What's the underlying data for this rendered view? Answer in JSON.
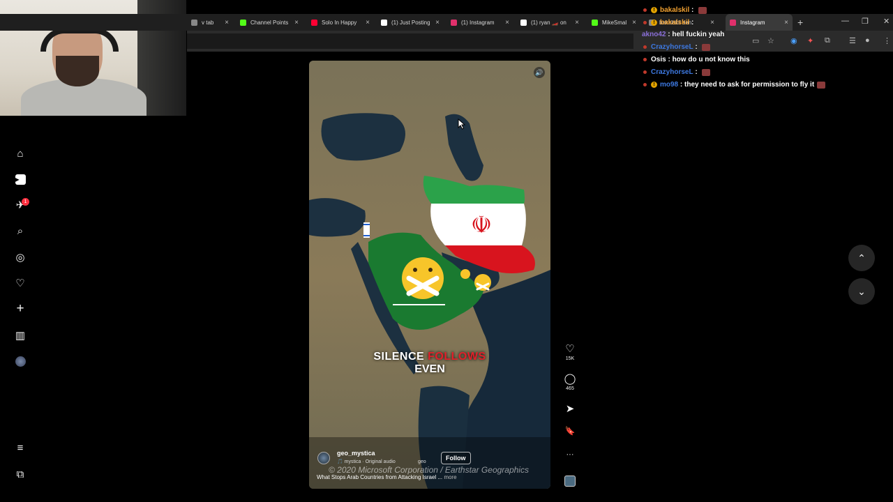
{
  "browser": {
    "tabs": [
      {
        "label": "v tab",
        "color": "#888888"
      },
      {
        "label": "Channel Points",
        "color": "#53fc18"
      },
      {
        "label": "Solo In Happy",
        "color": "#ff0033"
      },
      {
        "label": "(1) Just Posting",
        "color": "#ffffff"
      },
      {
        "label": "(1) Instagram",
        "color": "#e1306c"
      },
      {
        "label": "(1) ryan 🏎️ on",
        "color": "#ffffff"
      },
      {
        "label": "MikeSmallsJr",
        "color": "#53fc18"
      },
      {
        "label": "bakalskil den",
        "color": "#888888"
      },
      {
        "label": "Instagram",
        "color": "#e1306c"
      }
    ],
    "new_tab": "+",
    "minimize": "—",
    "restore": "❐",
    "close": "✕"
  },
  "chat": [
    {
      "user": "bakalskil",
      "text": "",
      "user_color": "#f0a030",
      "badge": true,
      "emote": true
    },
    {
      "user": "bakalskil",
      "text": "",
      "user_color": "#f0a030",
      "badge": true,
      "emote": false
    },
    {
      "user": "akno42",
      "text": "hell fuckin yeah",
      "user_color": "#8a6fd8",
      "badge": false,
      "emote": false
    },
    {
      "user": "CrazyhorseL",
      "text": "",
      "user_color": "#3d78e0",
      "badge": false,
      "emote": true
    },
    {
      "user": "Osis",
      "text": "how do u not know this",
      "user_color": "#ffffff",
      "badge": false,
      "emote": false
    },
    {
      "user": "CrazyhorseL",
      "text": "",
      "user_color": "#3d78e0",
      "badge": false,
      "emote": true
    },
    {
      "user": "mo98",
      "text": "they need to ask for permission to fly it",
      "user_color": "#3d78e0",
      "badge": true,
      "emote": true
    }
  ],
  "nav": {
    "home": "⌂",
    "reels": "▶",
    "messages": "✈",
    "notif_count": "1",
    "search": "⌕",
    "explore": "◎",
    "notifications": "♡",
    "create": "+",
    "dashboard": "▥",
    "menu": "≡",
    "also_from_meta": "⧉"
  },
  "reel": {
    "caption_white": "SILENCE",
    "caption_red": "FOLLOWS",
    "caption_line2": "EVEN",
    "credit": "© 2020 Microsoft Corporation / Earthstar Geographics",
    "account": "geo_mystica",
    "audio": "🎵 mystica · Original audio",
    "audio_tag": "geo",
    "follow": "Follow",
    "description": "What Stops Arab Countries from Attacking Israel ...",
    "more": "more",
    "speaker": "🔊"
  },
  "actions": {
    "like": "♡",
    "likes": "15K",
    "comment": "◯",
    "comments": "465",
    "share": "➤",
    "save": "🔖",
    "more": "···"
  },
  "scroll": {
    "up": "⌃",
    "down": "⌄"
  }
}
